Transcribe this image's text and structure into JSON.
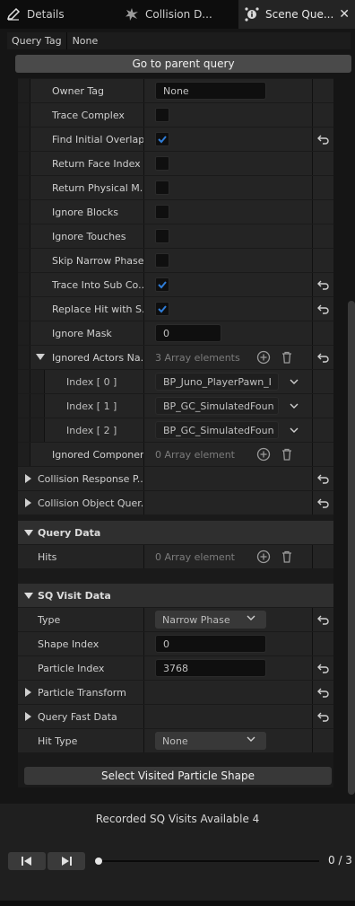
{
  "tabs": [
    {
      "label": "Details",
      "icon": "pencil-icon"
    },
    {
      "label": "Collision D...",
      "icon": "collision-icon"
    },
    {
      "label": "Scene Que...",
      "icon": "info-icon",
      "active": true
    }
  ],
  "query_tag": {
    "label": "Query Tag",
    "value": "None"
  },
  "go_to_parent_label": "Go to parent query",
  "properties": {
    "owner_tag": {
      "label": "Owner Tag",
      "value": "None"
    },
    "trace_complex": {
      "label": "Trace Complex",
      "checked": false
    },
    "find_initial_overlaps": {
      "label": "Find Initial Overlaps",
      "checked": true
    },
    "return_face_index": {
      "label": "Return Face Index",
      "checked": false
    },
    "return_physical_material": {
      "label": "Return Physical M...",
      "checked": false
    },
    "ignore_blocks": {
      "label": "Ignore Blocks",
      "checked": false
    },
    "ignore_touches": {
      "label": "Ignore Touches",
      "checked": false
    },
    "skip_narrow_phase": {
      "label": "Skip Narrow Phase",
      "checked": false
    },
    "trace_into_sub_components": {
      "label": "Trace Into Sub Co...",
      "checked": true
    },
    "replace_hit_with_sub": {
      "label": "Replace Hit with S...",
      "checked": true
    },
    "ignore_mask": {
      "label": "Ignore Mask",
      "value": "0"
    },
    "ignored_actors": {
      "label": "Ignored Actors Na...",
      "summary": "3 Array elements",
      "items": [
        {
          "label": "Index [ 0 ]",
          "value": "BP_Juno_PlayerPawn_I"
        },
        {
          "label": "Index [ 1 ]",
          "value": "BP_GC_SimulatedFoun"
        },
        {
          "label": "Index [ 2 ]",
          "value": "BP_GC_SimulatedFoun"
        }
      ]
    },
    "ignored_components": {
      "label": "Ignored Componen...",
      "summary": "0 Array element"
    },
    "collision_response": {
      "label": "Collision Response P..."
    },
    "collision_object_query": {
      "label": "Collision Object Quer..."
    }
  },
  "query_data": {
    "title": "Query Data",
    "hits": {
      "label": "Hits",
      "summary": "0 Array element"
    }
  },
  "sq_visit_data": {
    "title": "SQ Visit Data",
    "type": {
      "label": "Type",
      "value": "Narrow Phase"
    },
    "shape_index": {
      "label": "Shape Index",
      "value": "0"
    },
    "particle_index": {
      "label": "Particle Index",
      "value": "3768"
    },
    "particle_transform": {
      "label": "Particle Transform"
    },
    "query_fast_data": {
      "label": "Query Fast Data"
    },
    "hit_type": {
      "label": "Hit Type",
      "value": "None"
    }
  },
  "select_visited_label": "Select Visited Particle Shape",
  "recorded_visits_label": "Recorded SQ Visits Available 4",
  "playback": {
    "counter": "0 / 3",
    "progress": 0
  }
}
